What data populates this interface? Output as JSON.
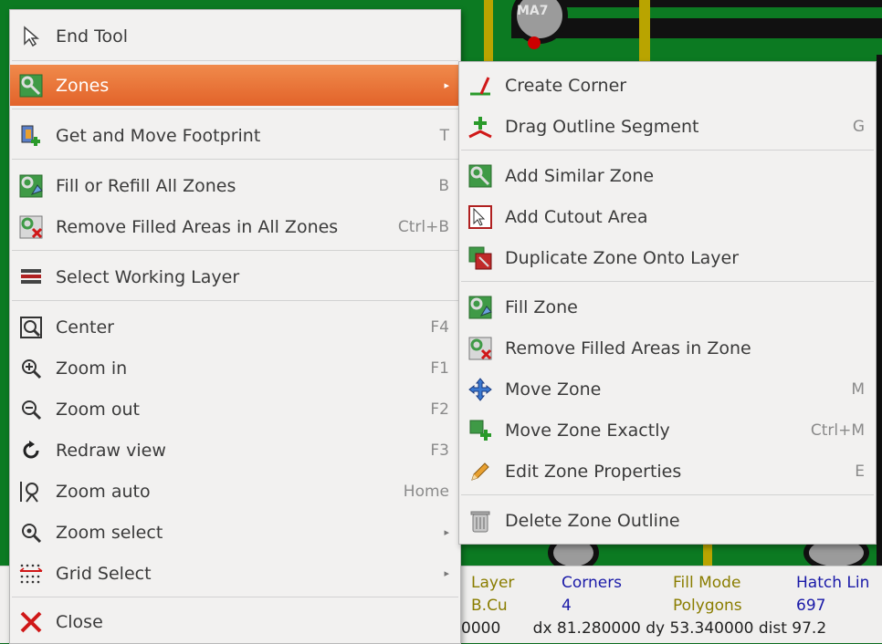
{
  "main_menu": {
    "items": [
      {
        "label": "End Tool",
        "shortcut": "",
        "icon": "cursor-icon"
      },
      {
        "label": "Zones",
        "shortcut": "",
        "icon": "zone-icon",
        "submenu": true,
        "highlighted": true
      },
      {
        "label": "Get and Move Footprint",
        "shortcut": "T",
        "icon": "footprint-move-icon"
      },
      {
        "label": "Fill or Refill All Zones",
        "shortcut": "B",
        "icon": "fill-zones-icon"
      },
      {
        "label": "Remove Filled Areas in All Zones",
        "shortcut": "Ctrl+B",
        "icon": "unfill-zones-icon"
      },
      {
        "label": "Select Working Layer",
        "shortcut": "",
        "icon": "layers-icon"
      },
      {
        "label": "Center",
        "shortcut": "F4",
        "icon": "center-icon"
      },
      {
        "label": "Zoom in",
        "shortcut": "F1",
        "icon": "zoom-in-icon"
      },
      {
        "label": "Zoom out",
        "shortcut": "F2",
        "icon": "zoom-out-icon"
      },
      {
        "label": "Redraw view",
        "shortcut": "F3",
        "icon": "redraw-icon"
      },
      {
        "label": "Zoom auto",
        "shortcut": "Home",
        "icon": "zoom-auto-icon"
      },
      {
        "label": "Zoom select",
        "shortcut": "",
        "icon": "zoom-select-icon",
        "submenu": true
      },
      {
        "label": "Grid Select",
        "shortcut": "",
        "icon": "grid-icon",
        "submenu": true
      },
      {
        "label": "Close",
        "shortcut": "",
        "icon": "close-icon"
      }
    ]
  },
  "submenu": {
    "items": [
      {
        "label": "Create Corner",
        "shortcut": "",
        "icon": "create-corner-icon"
      },
      {
        "label": "Drag Outline Segment",
        "shortcut": "G",
        "icon": "drag-segment-icon"
      },
      {
        "label": "Add Similar Zone",
        "shortcut": "",
        "icon": "add-similar-zone-icon"
      },
      {
        "label": "Add Cutout Area",
        "shortcut": "",
        "icon": "cutout-icon"
      },
      {
        "label": "Duplicate Zone Onto Layer",
        "shortcut": "",
        "icon": "duplicate-zone-icon"
      },
      {
        "label": "Fill Zone",
        "shortcut": "",
        "icon": "fill-zone-icon"
      },
      {
        "label": "Remove Filled Areas in Zone",
        "shortcut": "",
        "icon": "unfill-zone-icon"
      },
      {
        "label": "Move Zone",
        "shortcut": "M",
        "icon": "move-icon"
      },
      {
        "label": "Move Zone Exactly",
        "shortcut": "Ctrl+M",
        "icon": "move-exactly-icon"
      },
      {
        "label": "Edit Zone Properties",
        "shortcut": "E",
        "icon": "pencil-icon"
      },
      {
        "label": "Delete Zone Outline",
        "shortcut": "",
        "icon": "trash-icon"
      }
    ]
  },
  "status_bar": {
    "layer_label": "Layer",
    "layer_value": "B.Cu",
    "corners_label": "Corners",
    "corners_value": "4",
    "fill_mode_label": "Fill Mode",
    "fill_mode_value": "Polygons",
    "hatch_label": "Hatch Lin",
    "hatch_value": "697",
    "coords": "dx 81.280000 dy 53.340000 dist 97.2",
    "left_fragment": "0000"
  },
  "board": {
    "pad_label": "MA7"
  },
  "colors": {
    "highlight": "#e8713a",
    "board": "#0c7a22",
    "trace": "#b9a400"
  }
}
